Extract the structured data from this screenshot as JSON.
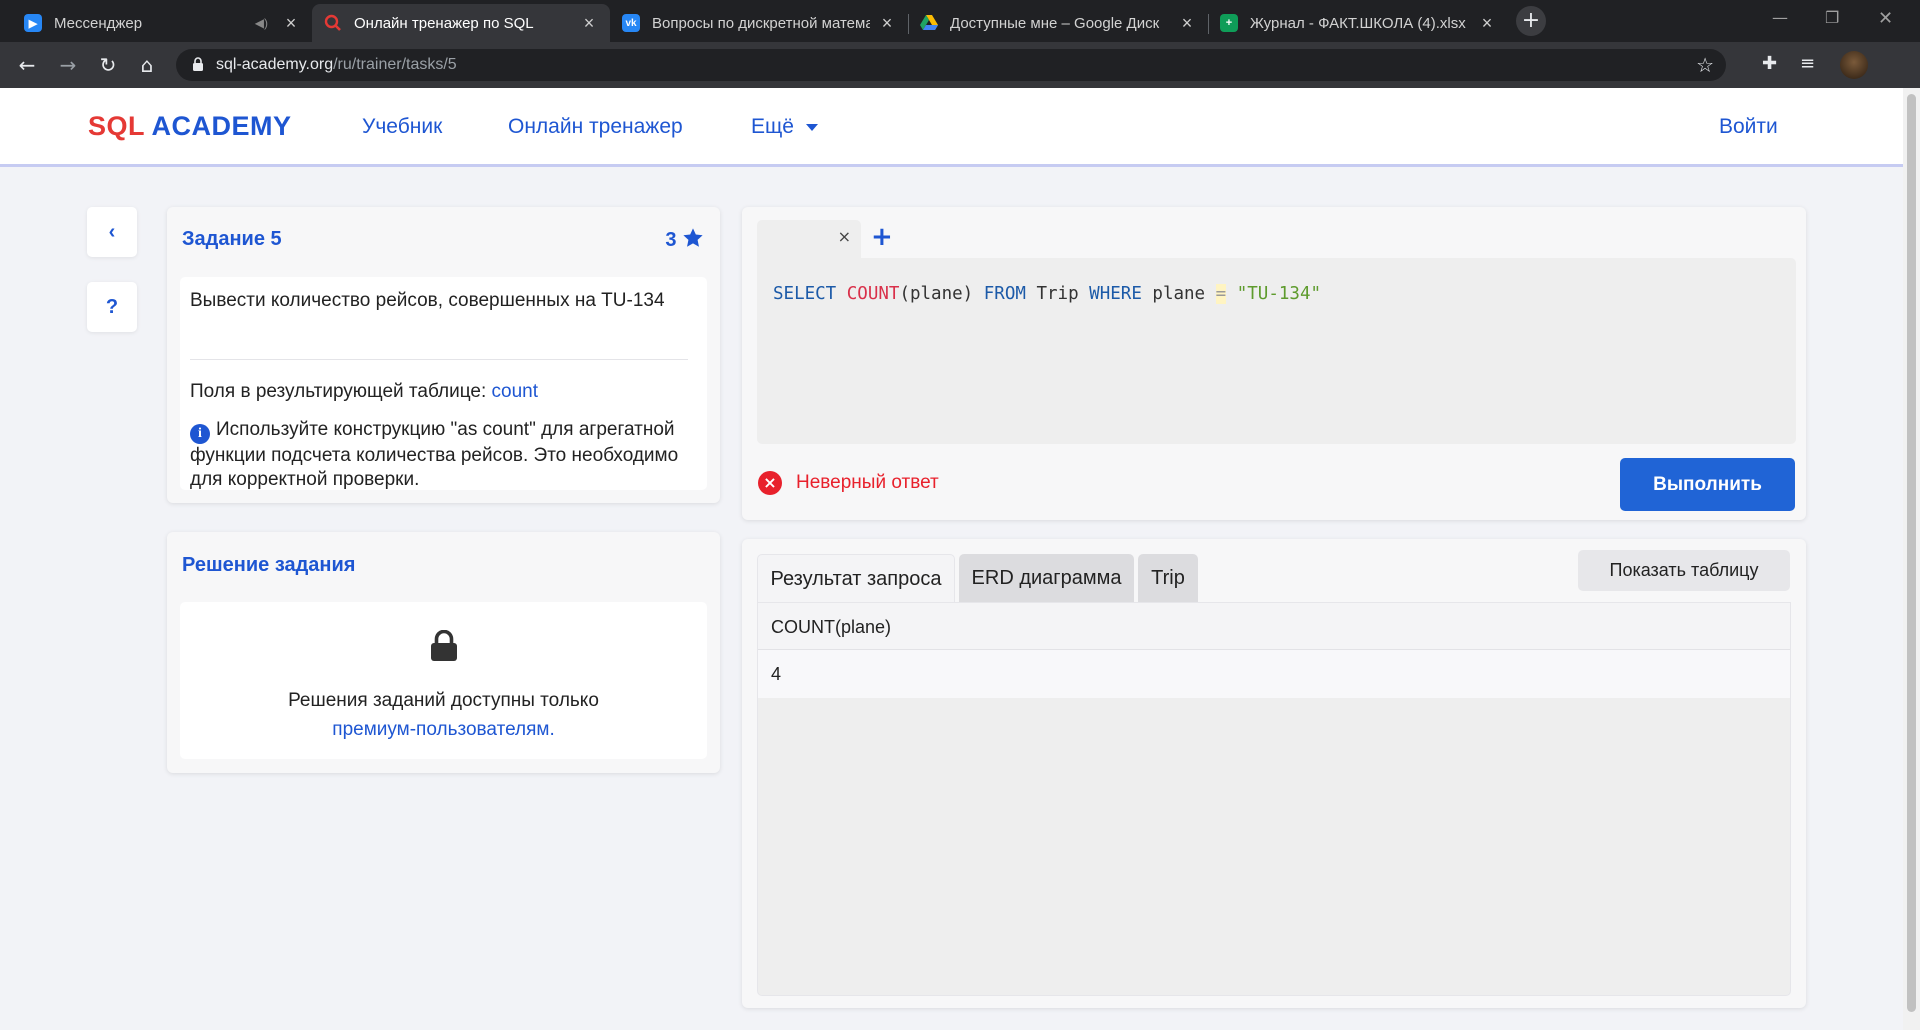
{
  "browser": {
    "tabs": [
      {
        "title": "Мессенджер",
        "favicon_color": "#2787f5",
        "active": false
      },
      {
        "title": "Онлайн тренажер по SQL",
        "favicon_color": "#e53935",
        "active": true
      },
      {
        "title": "Вопросы по дискретной математике",
        "favicon_color": "#2787f5",
        "active": false
      },
      {
        "title": "Доступные мне – Google Диск",
        "favicon_color": "#1fa463",
        "active": false
      },
      {
        "title": "Журнал - ФАКТ.ШКОЛА (4).xlsx",
        "favicon_color": "#0f9d58",
        "active": false
      }
    ],
    "url_host": "sql-academy.org",
    "url_path": "/ru/trainer/tasks/5"
  },
  "header": {
    "logo_sql": "SQL",
    "logo_academy": "ACADEMY",
    "nav": {
      "textbook": "Учебник",
      "trainer": "Онлайн тренажер",
      "more": "Ещё"
    },
    "login": "Войти"
  },
  "side": {
    "back_icon": "‹",
    "help_icon": "?"
  },
  "task": {
    "title": "Задание 5",
    "rating": "3",
    "description": "Вывести количество рейсов, совершенных на TU-134",
    "fields_label": "Поля в результирующей таблице:",
    "fields_value": "count",
    "hint": "Используйте конструкцию \"as count\" для агрегатной функции подсчета количества рейсов. Это необходимо для корректной проверки."
  },
  "solution": {
    "title": "Решение задания",
    "locked_text": "Решения заданий доступны только",
    "premium_link": "премиум-пользователям",
    "period": "."
  },
  "editor": {
    "tokens": {
      "select": "SELECT",
      "count": "COUNT",
      "arg": "(plane)",
      "from": "FROM",
      "table": "Trip",
      "where": "WHERE",
      "col": "plane",
      "eq": "=",
      "value": "\"TU-134\""
    },
    "tab_close": "×",
    "add_tab": "+",
    "error_text": "Неверный ответ",
    "run_button": "Выполнить"
  },
  "results": {
    "tabs": [
      "Результат запроса",
      "ERD диаграмма",
      "Trip"
    ],
    "active_tab": 0,
    "show_table_button": "Показать таблицу",
    "columns": [
      "COUNT(plane)"
    ],
    "rows": [
      [
        "4"
      ]
    ]
  }
}
